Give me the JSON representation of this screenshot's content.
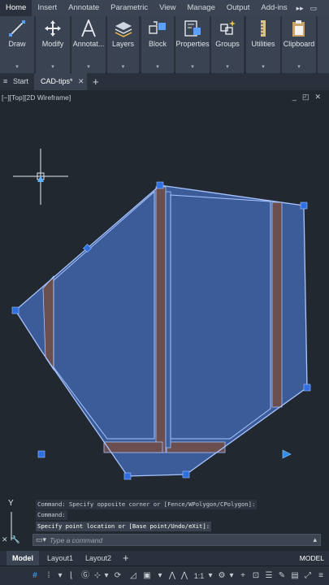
{
  "ribbon": {
    "tabs": [
      "Home",
      "Insert",
      "Annotate",
      "Parametric",
      "View",
      "Manage",
      "Output",
      "Add-ins"
    ],
    "active_tab": "Home",
    "more_tabs_glyph": "▸▸",
    "panels": [
      {
        "label": "Draw",
        "icon": "draw-line-icon"
      },
      {
        "label": "Modify",
        "icon": "move-arrows-icon"
      },
      {
        "label": "Annotat...",
        "icon": "text-a-icon"
      },
      {
        "label": "Layers",
        "icon": "layers-icon"
      },
      {
        "label": "Block",
        "icon": "block-icon"
      },
      {
        "label": "Properties",
        "icon": "properties-icon"
      },
      {
        "label": "Groups",
        "icon": "groups-icon"
      },
      {
        "label": "Utilities",
        "icon": "measure-icon"
      },
      {
        "label": "Clipboard",
        "icon": "clipboard-icon"
      }
    ]
  },
  "doc_tabs": {
    "start": "Start",
    "active": "CAD-tips*",
    "new_tab": "+"
  },
  "viewport": {
    "label": "[−][Top][2D Wireframe]",
    "controls": [
      "_",
      "◰",
      "✕"
    ],
    "ucs_y_label": "Y"
  },
  "command": {
    "history": [
      "Command: Specify opposite corner or [Fence/WPolygon/CPolygon]:",
      "Command:",
      "Specify point location or [Base point/Undo/eXit]:"
    ],
    "placeholder": "Type a command"
  },
  "layout_tabs": {
    "tabs": [
      "Model",
      "Layout1",
      "Layout2"
    ],
    "active": "Model",
    "add": "+",
    "model_indicator": "MODEL"
  },
  "status_bar": {
    "scale": "1:1",
    "items": [
      "grid-icon",
      "snap-icon",
      "ortho-icon",
      "polar-icon",
      "osnap-icon",
      "annotation-scale-icon",
      "workspace-icon",
      "fullscreen-icon"
    ]
  },
  "colors": {
    "selection_fill": "#3f62a3",
    "wall_fill": "#6b4e4e",
    "outline": "#a8c4ff",
    "grip": "#2f6fe0",
    "background": "#212830"
  }
}
